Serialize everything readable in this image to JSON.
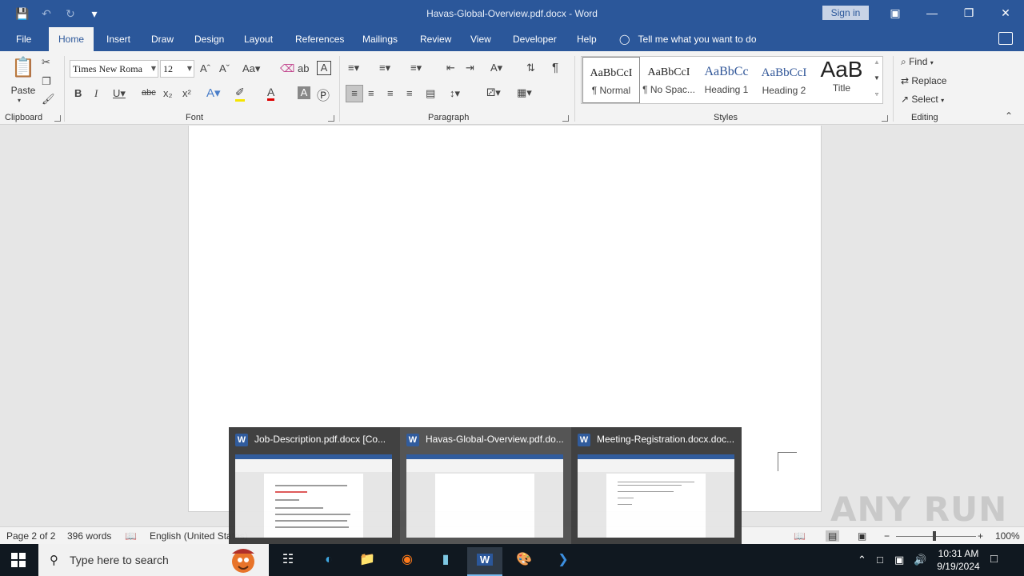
{
  "window": {
    "title": "Havas-Global-Overview.pdf.docx  -  Word",
    "sign_in": "Sign in"
  },
  "ribbon_tabs": [
    "File",
    "Home",
    "Insert",
    "Draw",
    "Design",
    "Layout",
    "References",
    "Mailings",
    "Review",
    "View",
    "Developer",
    "Help"
  ],
  "tell_me": "Tell me what you want to do",
  "clipboard": {
    "paste": "Paste",
    "label": "Clipboard"
  },
  "font": {
    "name": "Times New Roma",
    "size": "12",
    "label": "Font"
  },
  "paragraph": {
    "label": "Paragraph"
  },
  "styles": {
    "label": "Styles",
    "items": [
      {
        "sample": "AaBbCcI",
        "name": "¶ Normal"
      },
      {
        "sample": "AaBbCcI",
        "name": "¶ No Spac..."
      },
      {
        "sample": "AaBbCc",
        "name": "Heading 1"
      },
      {
        "sample": "AaBbCcI",
        "name": "Heading 2"
      },
      {
        "sample": "AaB",
        "name": "Title"
      }
    ]
  },
  "editing": {
    "label": "Editing",
    "find": "Find",
    "replace": "Replace",
    "select": "Select"
  },
  "status": {
    "page": "Page 2 of 2",
    "words": "396 words",
    "language": "English (United States)",
    "zoom": "100%"
  },
  "thumbnails": [
    {
      "label": "Job-Description.pdf.docx [Co..."
    },
    {
      "label": "Havas-Global-Overview.pdf.do..."
    },
    {
      "label": "Meeting-Registration.docx.doc..."
    }
  ],
  "taskbar": {
    "search_placeholder": "Type here to search",
    "time": "10:31 AM",
    "date": "9/19/2024"
  },
  "watermark": "ANY RUN",
  "colors": {
    "word_blue": "#2b579a",
    "taskbar": "#101820"
  }
}
